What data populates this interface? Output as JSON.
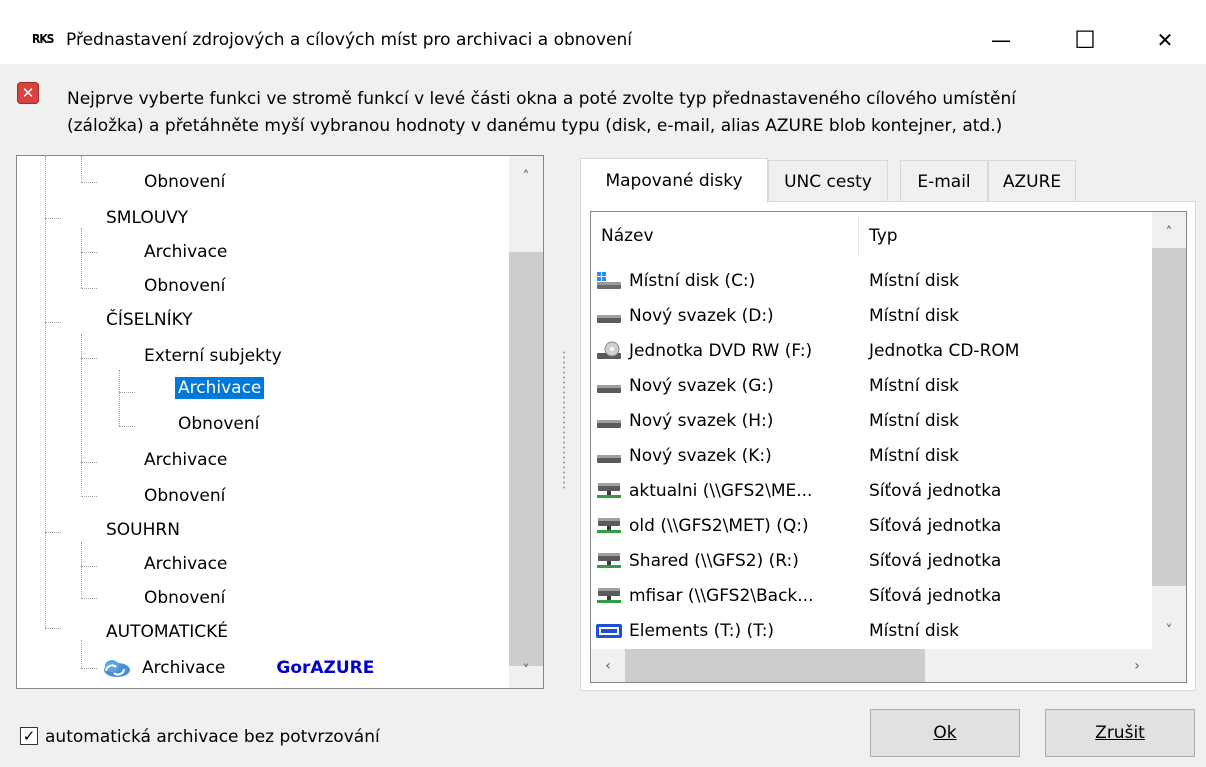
{
  "window": {
    "icon_text": "RKS",
    "title": "Přednastavení zdrojových a cílových míst pro archivaci a obnovení",
    "min_glyph": "—",
    "max_glyph": "☐",
    "close_glyph": "✕"
  },
  "info": {
    "icon_glyph": "✕",
    "line1": "Nejprve vyberte funkci ve stromě funkcí v levé části okna a poté zvolte typ přednastaveného cílového umístění",
    "line2": "(záložka) a přetáhněte myší vybranou hodnoty v danému typu (disk, e-mail,  alias AZURE blob kontejner, atd.)"
  },
  "tree": {
    "items": [
      {
        "label": "Obnovení"
      },
      {
        "label": "SMLOUVY"
      },
      {
        "label": "Archivace"
      },
      {
        "label": "Obnovení"
      },
      {
        "label": "ČÍSELNÍKY"
      },
      {
        "label": "Externí subjekty"
      },
      {
        "label": "Archivace",
        "selected": true
      },
      {
        "label": "Obnovení"
      },
      {
        "label": "Archivace"
      },
      {
        "label": "Obnovení"
      },
      {
        "label": "SOUHRN"
      },
      {
        "label": "Archivace"
      },
      {
        "label": "Obnovení"
      },
      {
        "label": "AUTOMATICKÉ"
      },
      {
        "label": "Archivace",
        "tag": "GorAZURE"
      }
    ],
    "tag_color": "#0000cc",
    "selected_color": "#0078d7"
  },
  "tabs": [
    {
      "label": "Mapované disky",
      "active": true
    },
    {
      "label": "UNC cesty"
    },
    {
      "label": "E-mail"
    },
    {
      "label": "AZURE"
    }
  ],
  "list": {
    "columns": [
      "Název",
      "Typ"
    ],
    "rows": [
      {
        "icon": "windows-drive-icon",
        "name": "Místní disk (C:)",
        "type": "Místní disk"
      },
      {
        "icon": "drive-icon",
        "name": "Nový svazek (D:)",
        "type": "Místní disk"
      },
      {
        "icon": "dvd-drive-icon",
        "name": "Jednotka DVD RW (F:)",
        "type": "Jednotka CD-ROM"
      },
      {
        "icon": "drive-icon",
        "name": "Nový svazek (G:)",
        "type": "Místní disk"
      },
      {
        "icon": "drive-icon",
        "name": "Nový svazek (H:)",
        "type": "Místní disk"
      },
      {
        "icon": "drive-icon",
        "name": "Nový svazek (K:)",
        "type": "Místní disk"
      },
      {
        "icon": "network-drive-icon",
        "name": "aktualni (\\\\GFS2\\ME...",
        "type": "Síťová jednotka"
      },
      {
        "icon": "network-drive-icon",
        "name": "old (\\\\GFS2\\MET) (Q:)",
        "type": "Síťová jednotka"
      },
      {
        "icon": "network-drive-icon",
        "name": "Shared (\\\\GFS2) (R:)",
        "type": "Síťová jednotka"
      },
      {
        "icon": "network-drive-icon",
        "name": "mfisar (\\\\GFS2\\Back...",
        "type": "Síťová jednotka"
      },
      {
        "icon": "wd-drive-icon",
        "name": "Elements (T:) (T:)",
        "type": "Místní disk"
      }
    ]
  },
  "footer": {
    "checkbox_label": "automatická archivace bez potvrzování",
    "checked": true,
    "ok_label": "Ok",
    "cancel_label": "Zrušit"
  },
  "scroll": {
    "up": "˄",
    "down": "˅",
    "left": "‹",
    "right": "›"
  }
}
